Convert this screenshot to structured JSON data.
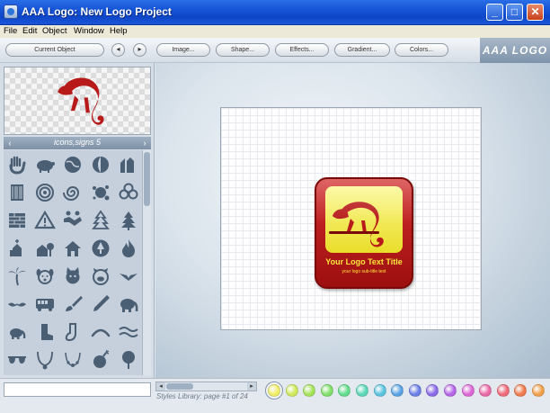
{
  "window": {
    "title": "AAA Logo: New Logo Project"
  },
  "window_controls": {
    "minimize": "_",
    "maximize": "□",
    "close": "✕"
  },
  "menu": [
    "File",
    "Edit",
    "Object",
    "Window",
    "Help"
  ],
  "toolbar": {
    "current_object": "Current Object",
    "prev": "◂",
    "next": "▸",
    "image": "Image...",
    "shape": "Shape...",
    "effects": "Effects...",
    "gradient": "Gradient...",
    "colors": "Colors...",
    "brand": "AAA LOGO"
  },
  "library": {
    "category": "icons,signs 5",
    "prev": "‹",
    "next": "›",
    "icons": [
      "hand-icon",
      "pig-icon",
      "globe-icon",
      "globe-half-icon",
      "barn-icon",
      "barcode-icon",
      "spiral-icon",
      "swirl-icon",
      "splat-icon",
      "clover-icon",
      "brick-wall-icon",
      "warning-sign-icon",
      "handshake-icon",
      "tree-snowy-icon",
      "pine-tree-icon",
      "church-icon",
      "house-tree-icon",
      "house-icon",
      "nature-badge-icon",
      "flame-icon",
      "palm-tree-icon",
      "dog-face-icon",
      "cat-face-icon",
      "pig-face-icon",
      "wings-emblem-icon",
      "mustache-icon",
      "bus-icon",
      "paintbrush-icon",
      "pen-icon",
      "elephant-icon",
      "elephant-small-icon",
      "boot-icon",
      "sock-icon",
      "arc-icon",
      "waves-icon",
      "sunglasses-icon",
      "necklace-icon",
      "beads-icon",
      "bomb-icon",
      "tree-bush-icon"
    ]
  },
  "logo": {
    "title": "Your Logo Text Title",
    "subtitle": "your logo sub-title text"
  },
  "styles": {
    "label": "Styles Library: page #1 of 24",
    "prev": "◂",
    "next": "▸"
  },
  "palette": {
    "selected_index": 0,
    "colors": [
      "#f0ee6a",
      "#cfe85a",
      "#a6e35a",
      "#7fdf6a",
      "#63dd8c",
      "#5ad8b8",
      "#5ac4df",
      "#5aa3e3",
      "#6a7fe6",
      "#8a6ae8",
      "#b466e6",
      "#dc66d6",
      "#ea6aa8",
      "#ee6a78",
      "#ef7a4e",
      "#f0a04a"
    ]
  }
}
